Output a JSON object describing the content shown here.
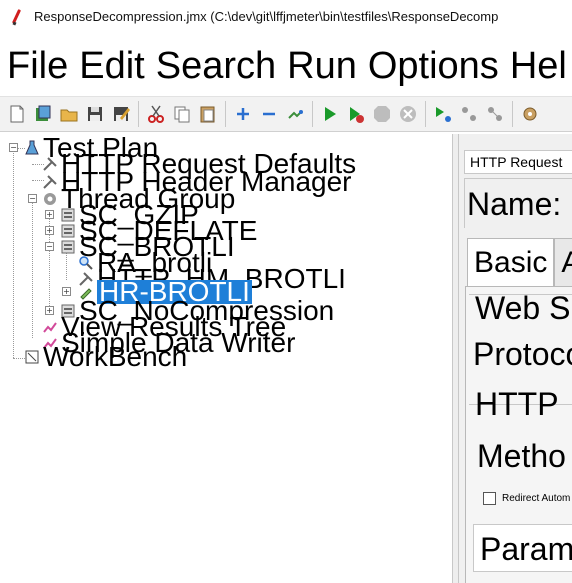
{
  "window": {
    "title": "ResponseDecompression.jmx (C:\\dev\\git\\lffjmeter\\bin\\testfiles\\ResponseDecomp"
  },
  "menu": {
    "file": "File",
    "edit": "Edit",
    "search": "Search",
    "run": "Run",
    "options": "Options",
    "help": "Hel"
  },
  "toolbar": {
    "icons": [
      "new-icon",
      "templates-icon",
      "open-icon",
      "save-icon",
      "save-as-icon",
      "cut-icon",
      "copy-icon",
      "paste-icon",
      "expand-icon",
      "collapse-icon",
      "toggle-icon",
      "start-icon",
      "start-no-pause-icon",
      "stop-icon",
      "shutdown-icon",
      "remote-start-icon",
      "remote-stop-icon",
      "remote-shutdown-icon",
      "settings-icon"
    ]
  },
  "tree": {
    "nodes": [
      {
        "label": "Test Plan"
      },
      {
        "label": "HTTP Request Defaults"
      },
      {
        "label": "HTTP Header Manager"
      },
      {
        "label": "Thread Group"
      },
      {
        "label": "SC_GZIP"
      },
      {
        "label": "SC_DEFLATE"
      },
      {
        "label": "SC_BROTLI"
      },
      {
        "label": "RA_brotli"
      },
      {
        "label": "HTTP_HM_BROTLI"
      },
      {
        "label": "HR-BROTLI"
      },
      {
        "label": "SC_NoCompression"
      },
      {
        "label": "View Results Tree"
      },
      {
        "label": "Simple Data Writer"
      },
      {
        "label": "WorkBench"
      }
    ],
    "expanders": {
      "collapse": "−",
      "expand": "+"
    }
  },
  "panel": {
    "header": "HTTP Request",
    "name_label": "Name:",
    "tab_basic": "Basic",
    "tab_advanced": "A",
    "web_server": "Web S",
    "protocol": "Protoco",
    "http_request": "HTTP",
    "method": "Metho",
    "redirect": "Redirect Autom",
    "parameters": "Param"
  },
  "colors": {
    "selection": "#1e7fd8",
    "start_green": "#1a9a2a",
    "add_blue": "#2a6fd0"
  }
}
